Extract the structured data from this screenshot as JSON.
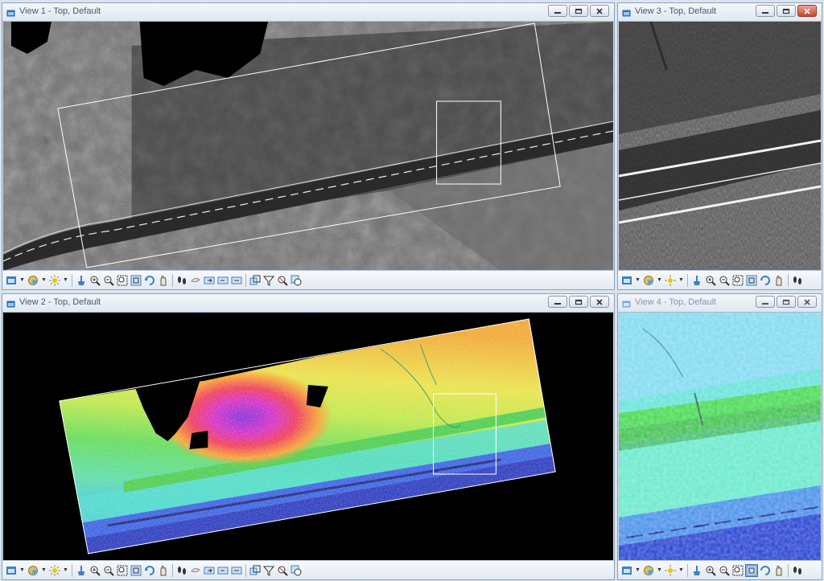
{
  "windows": {
    "view1": {
      "title": "View 1 - Top, Default",
      "active": true
    },
    "view2": {
      "title": "View 2 - Top, Default",
      "active": true
    },
    "view3": {
      "title": "View 3 - Top, Default",
      "active": true
    },
    "view4": {
      "title": "View 4 - Top, Default",
      "active": false
    }
  },
  "window_buttons": {
    "minimize": "minimize-icon",
    "restore": "restore-icon",
    "close": "close-icon"
  },
  "view_toolbar_icons": [
    "view-attributes-icon",
    "view-display-mode-icon",
    "lighting-icon",
    "clear-icon",
    "zoom-in-icon",
    "zoom-out-icon",
    "window-area-icon",
    "fit-view-icon",
    "rotate-view-icon",
    "pan-view-icon",
    "walk-icon",
    "previous-view-icon",
    "next-view-icon",
    "copy-view-icon",
    "clip-volume-icon",
    "clip-mask-icon",
    "update-icon"
  ],
  "colors": {
    "title_active": "#4a5866",
    "title_inactive": "#8896a4",
    "close_active": "#c8452c"
  }
}
